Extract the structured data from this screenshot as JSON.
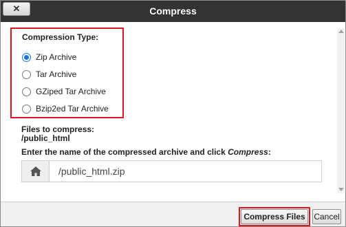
{
  "dialog": {
    "title": "Compress",
    "close_label": "✕"
  },
  "compression": {
    "title": "Compression Type:",
    "options": [
      {
        "label": "Zip Archive",
        "checked": true
      },
      {
        "label": "Tar Archive",
        "checked": false
      },
      {
        "label": "GZiped Tar Archive",
        "checked": false
      },
      {
        "label": "Bzip2ed Tar Archive",
        "checked": false
      }
    ]
  },
  "files": {
    "label": "Files to compress:",
    "value": "/public_html"
  },
  "instruction": {
    "text": "Enter the name of the compressed archive and click",
    "action": "Compress",
    "suffix": ":"
  },
  "archive_input": {
    "value": "/public_html.zip",
    "icon": "home-icon"
  },
  "buttons": {
    "compress": "Compress Files",
    "cancel": "Cancel"
  },
  "colors": {
    "titlebar": "#333333",
    "highlight": "#e0121d",
    "radio_checked": "#1a73e8"
  }
}
